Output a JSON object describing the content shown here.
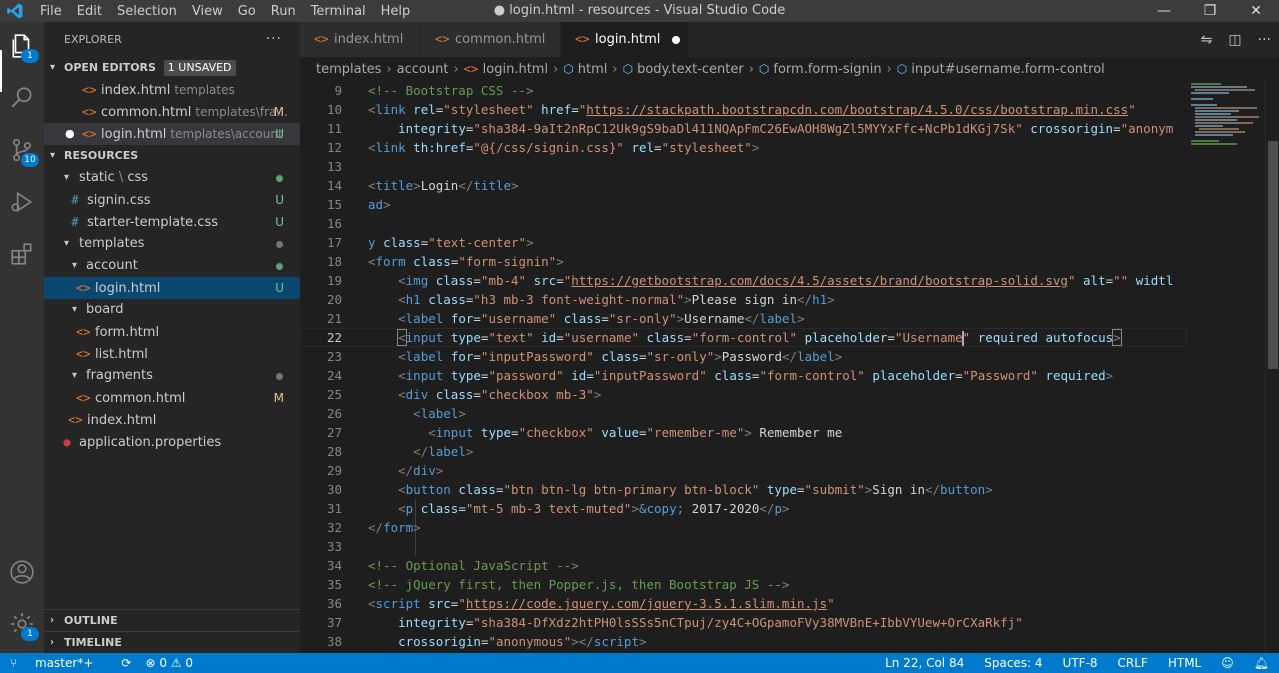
{
  "titlebar": {
    "menu": [
      "File",
      "Edit",
      "Selection",
      "View",
      "Go",
      "Run",
      "Terminal",
      "Help"
    ],
    "title": "● login.html - resources - Visual Studio Code"
  },
  "activity": {
    "explorer_badge": "1",
    "scm_badge": "10",
    "settings_badge": "1"
  },
  "explorer": {
    "title": "EXPLORER",
    "more": "···",
    "open_editors": {
      "label": "OPEN EDITORS",
      "badge": "1 UNSAVED",
      "items": [
        {
          "name": "index.html",
          "desc": "templates",
          "status": ""
        },
        {
          "name": "common.html",
          "desc": "templates\\fra...",
          "status": "M"
        },
        {
          "name": "login.html",
          "desc": "templates\\account",
          "status": "U"
        }
      ]
    },
    "workspace": {
      "label": "RESOURCES",
      "items": [
        {
          "name": "static",
          "name2": "css",
          "type": "folder"
        },
        {
          "name": "signin.css",
          "status": "U"
        },
        {
          "name": "starter-template.css",
          "status": "U"
        },
        {
          "name": "templates",
          "type": "folder"
        },
        {
          "name": "account",
          "type": "folder"
        },
        {
          "name": "login.html",
          "status": "U"
        },
        {
          "name": "board",
          "type": "folder"
        },
        {
          "name": "form.html"
        },
        {
          "name": "list.html"
        },
        {
          "name": "fragments",
          "type": "folder"
        },
        {
          "name": "common.html",
          "status": "M"
        },
        {
          "name": "index.html"
        },
        {
          "name": "application.properties"
        }
      ]
    },
    "outline": "OUTLINE",
    "timeline": "TIMELINE"
  },
  "tabs": [
    {
      "label": "index.html"
    },
    {
      "label": "common.html"
    },
    {
      "label": "login.html"
    }
  ],
  "breadcrumb": [
    "templates",
    "account",
    "login.html",
    "html",
    "body.text-center",
    "form.form-signin",
    "input#username.form-control"
  ],
  "code": {
    "line_numbers": [
      "9",
      "10",
      "11",
      "12",
      "13",
      "14",
      "15",
      "16",
      "17",
      "18",
      "19",
      "20",
      "21",
      "22",
      "23",
      "24",
      "25",
      "26",
      "27",
      "28",
      "29",
      "30",
      "31",
      "32",
      "33",
      "34",
      "35",
      "36",
      "37",
      "38"
    ]
  },
  "statusbar": {
    "branch": "master*+",
    "sync": "⟳",
    "problems": "⊗ 0 ⚠ 0",
    "position": "Ln 22, Col 84",
    "spaces": "Spaces: 4",
    "encoding": "UTF-8",
    "eol": "CRLF",
    "language": "HTML"
  },
  "colors": {
    "accent": "#007acc",
    "activity_bar": "#333333",
    "sidebar": "#252526",
    "editor": "#1e1e1e"
  },
  "icons": [
    "vscode-logo-icon",
    "explorer-icon",
    "search-icon",
    "source-control-icon",
    "run-debug-icon",
    "extensions-icon",
    "account-icon",
    "settings-gear-icon",
    "open-changes-icon",
    "split-editor-icon",
    "more-actions-icon",
    "branch-icon",
    "bell-icon",
    "feedback-icon"
  ]
}
